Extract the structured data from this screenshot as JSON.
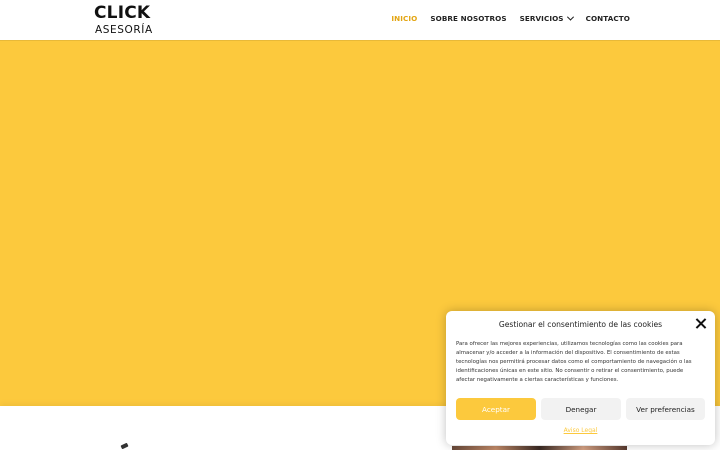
{
  "header": {
    "logo": {
      "title": "CLICK",
      "subtitle": "ASESORÍA"
    },
    "nav": [
      {
        "label": "INICIO",
        "active": true
      },
      {
        "label": "SOBRE NOSOTROS"
      },
      {
        "label": "SERVICIOS",
        "has_dropdown": true
      },
      {
        "label": "CONTACTO"
      }
    ]
  },
  "colors": {
    "accent": "#fcc93d",
    "active_nav": "#e3a512"
  },
  "cookie_banner": {
    "title": "Gestionar el consentimiento de las cookies",
    "text": "Para ofrecer las mejores experiencias, utilizamos tecnologías como las cookies para almacenar y/o acceder a la información del dispositivo. El consentimiento de estas tecnologías nos permitirá procesar datos como el comportamiento de navegación o las identificaciones únicas en este sitio. No consentir o retirar el consentimiento, puede afectar negativamente a ciertas características y funciones.",
    "buttons": {
      "accept": "Aceptar",
      "deny": "Denegar",
      "preferences": "Ver preferencias"
    },
    "link": "Aviso Legal"
  }
}
